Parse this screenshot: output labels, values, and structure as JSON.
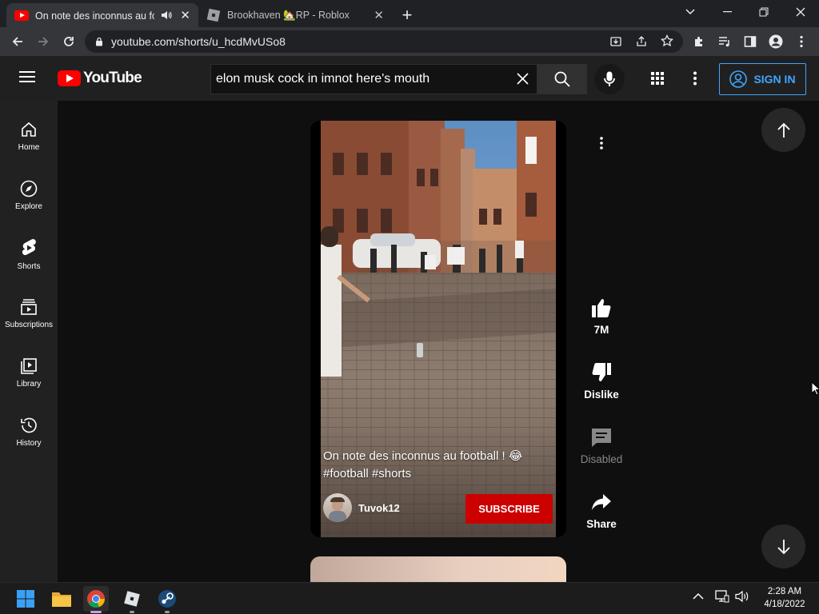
{
  "browser": {
    "tabs": [
      {
        "title": "On note des inconnus au football ! 😂 #football #shorts",
        "active": true
      },
      {
        "title": "Brookhaven 🏡RP - Roblox",
        "active": false
      }
    ],
    "url": "youtube.com/shorts/u_hcdMvUSo8"
  },
  "youtube": {
    "logo_text": "YouTube",
    "search": {
      "query": "elon musk cock in imnot here's mouth"
    },
    "sign_in_label": "SIGN IN",
    "guide": [
      {
        "label": "Home",
        "icon": "home-icon"
      },
      {
        "label": "Explore",
        "icon": "compass-icon"
      },
      {
        "label": "Shorts",
        "icon": "shorts-icon"
      },
      {
        "label": "Subscriptions",
        "icon": "subscriptions-icon"
      },
      {
        "label": "Library",
        "icon": "library-icon"
      },
      {
        "label": "History",
        "icon": "history-icon"
      }
    ],
    "short": {
      "title": "On note des inconnus au football ! 😂 #football #shorts",
      "channel": "Tuvok12",
      "subscribe_label": "SUBSCRIBE"
    },
    "actions": {
      "like_count": "7M",
      "dislike_label": "Dislike",
      "comments_label": "Disabled",
      "share_label": "Share"
    },
    "colors": {
      "accent": "#3ea6ff",
      "brand_red": "#ff0000",
      "subscribe": "#cc0000"
    }
  },
  "taskbar": {
    "time": "2:28 AM",
    "date": "4/18/2022"
  }
}
